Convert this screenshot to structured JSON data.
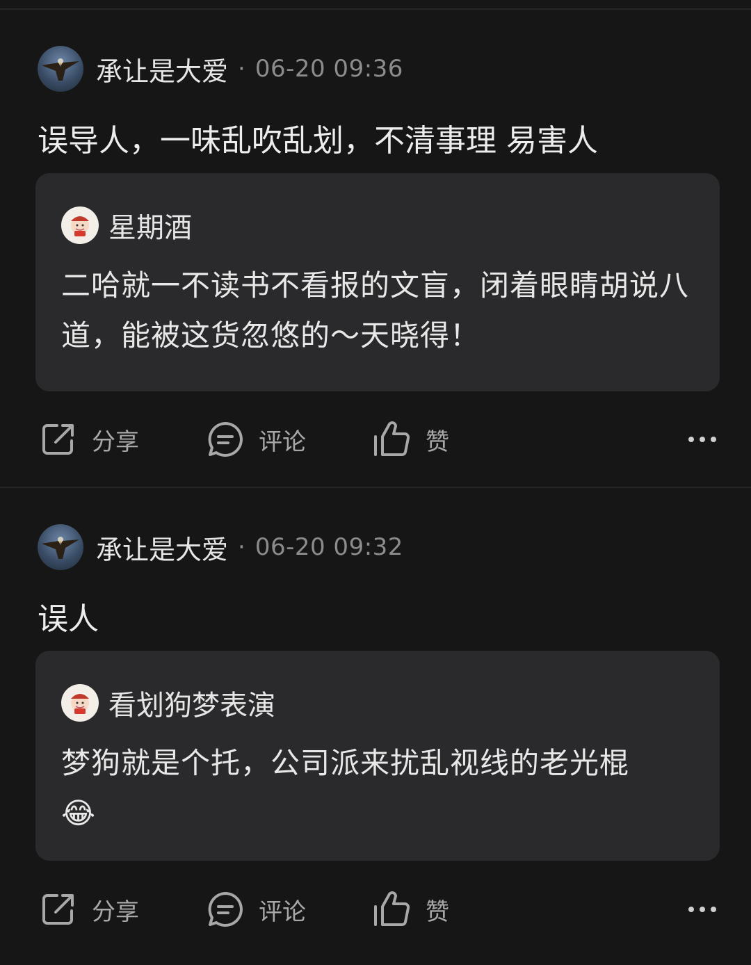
{
  "posts": [
    {
      "author": "承让是大爱",
      "separator": "·",
      "time": "06-20 09:36",
      "content": "误导人，一味乱吹乱划，不清事理 易害人",
      "quote": {
        "user": "星期酒",
        "text": "二哈就一不读书不看报的文盲，闭着眼睛胡说八道，能被这货忽悠的～天晓得！"
      }
    },
    {
      "author": "承让是大爱",
      "separator": "·",
      "time": "06-20 09:32",
      "content": "误人",
      "quote": {
        "user": "看划狗梦表演",
        "text": "梦狗就是个托，公司派来扰乱视线的老光棍",
        "emoji": "😂"
      }
    }
  ],
  "actions": {
    "share": "分享",
    "comment": "评论",
    "like": "赞"
  },
  "icons": {
    "share": "share-icon",
    "comment": "comment-icon",
    "like": "thumbs-up-icon",
    "more": "more-dots-icon"
  }
}
